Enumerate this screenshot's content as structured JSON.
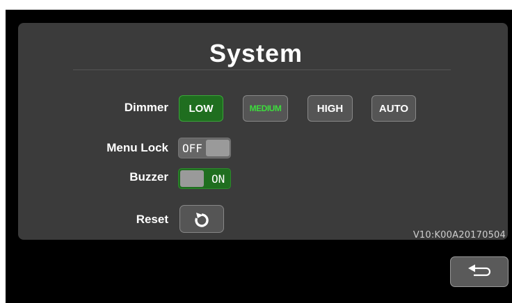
{
  "title": "System",
  "dimmer": {
    "label": "Dimmer",
    "options": [
      "LOW",
      "MEDIUM",
      "HIGH",
      "AUTO"
    ],
    "selected": "LOW"
  },
  "menu_lock": {
    "label": "Menu Lock",
    "state_text": "OFF",
    "state": "off"
  },
  "buzzer": {
    "label": "Buzzer",
    "state_text": "ON",
    "state": "on"
  },
  "reset": {
    "label": "Reset",
    "icon": "reset-icon"
  },
  "version": "V10:K00A20170504",
  "back": {
    "icon": "back-arrow-icon"
  },
  "colors": {
    "background": "#000000",
    "panel": "#3b3b3b",
    "selected_button": "#1f6e1f",
    "medium_text": "#3ddc3d",
    "button": "#555555"
  }
}
